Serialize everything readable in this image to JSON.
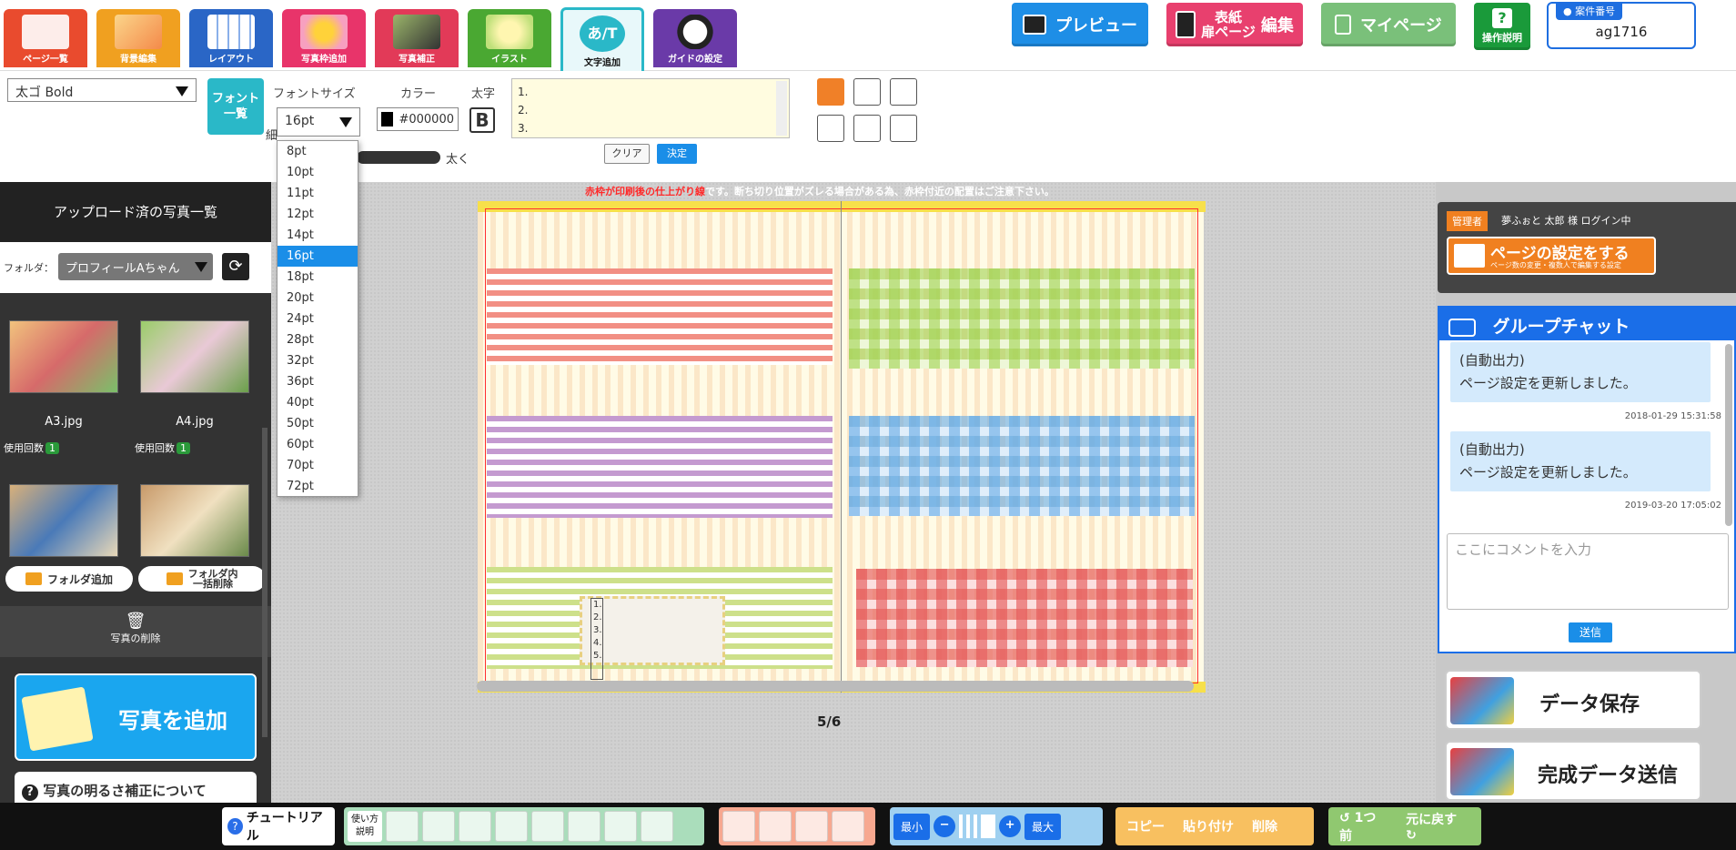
{
  "toolbar": {
    "tabs": [
      {
        "label": "ページ一覧",
        "color": "#e94b2e"
      },
      {
        "label": "背景編集",
        "color": "#f0a020"
      },
      {
        "label": "レイアウト",
        "color": "#2a66c6"
      },
      {
        "label": "写真枠追加",
        "color": "#e8346a"
      },
      {
        "label": "写真補正",
        "color": "#e23a58"
      },
      {
        "label": "イラスト",
        "color": "#4aa832"
      },
      {
        "label": "文字追加",
        "color": "#2ab8c8"
      },
      {
        "label": "ガイドの設定",
        "color": "#6a3aa8"
      }
    ],
    "preview_label": "プレビュー",
    "cover_line1": "表紙",
    "cover_line2": "扉ページ",
    "cover_edit": "編集",
    "mypage_label": "マイページ",
    "help_label": "操作説明",
    "case_number_label": "案件番号",
    "case_number_value": "ag1716"
  },
  "textpanel": {
    "font_name": "太ゴ Bold",
    "font_list_button": "フォント一覧",
    "font_size_label": "フォントサイズ",
    "font_size_value": "16pt",
    "color_label": "カラー",
    "color_value": "#000000",
    "bold_label": "太字",
    "bold_glyph": "B",
    "textarea_lines": [
      "1.",
      "2.",
      "3."
    ],
    "clear_button": "クリア",
    "confirm_button": "決定",
    "weight_thin": "細",
    "weight_thick": "太く",
    "font_sizes": [
      "8pt",
      "10pt",
      "11pt",
      "12pt",
      "14pt",
      "16pt",
      "18pt",
      "20pt",
      "24pt",
      "28pt",
      "32pt",
      "36pt",
      "40pt",
      "50pt",
      "60pt",
      "70pt",
      "72pt"
    ],
    "selected_size": "16pt"
  },
  "sidebar": {
    "title": "アップロード済の写真一覧",
    "folder_label": "フォルダ：",
    "folder_value": "プロフィールAちゃん",
    "photos": [
      {
        "name": "A3.jpg",
        "usage_label": "使用回数",
        "count": "1"
      },
      {
        "name": "A4.jpg",
        "usage_label": "使用回数",
        "count": "1"
      }
    ],
    "add_folder": "フォルダ追加",
    "folder_delete_line1": "フォルダ内",
    "folder_delete_line2": "一括削除",
    "delete_photos": "写真の削除",
    "add_photo": "写真を追加",
    "brightness_help": "写真の明るさ補正について"
  },
  "canvas": {
    "warning_red": "赤枠が印刷後の仕上がり線",
    "warning_white": "です。断ち切り位置がズレる場合がある為、赤枠付近の配置はご注意下さい。",
    "page_indicator": "5/6",
    "text_box_lines": [
      "1.",
      "2.",
      "3.",
      "4.",
      "5."
    ]
  },
  "rightpanel": {
    "admin_badge": "管理者",
    "login_text": "夢ふぉと 太郎 様 ログイン中",
    "page_settings_main": "ページの設定をする",
    "page_settings_sub": "ページ数の変更・複数人で編集する設定",
    "chat_title": "グループチャット",
    "messages": [
      {
        "line1": "(自動出力)",
        "line2": "ページ設定を更新しました。",
        "time": "2018-01-29 15:31:58"
      },
      {
        "line1": "(自動出力)",
        "line2": "ページ設定を更新しました。",
        "time": "2019-03-20 17:05:02"
      }
    ],
    "comment_placeholder": "ここにコメントを入力",
    "send_button": "送信",
    "save_data": "データ保存",
    "submit_data": "完成データ送信"
  },
  "bottombar": {
    "tutorial": "チュートリアル",
    "howto_line1": "使い方",
    "howto_line2": "説明",
    "zoom_min": "最小",
    "zoom_max": "最大",
    "copy": "コピー",
    "paste": "貼り付け",
    "delete": "削除",
    "undo": "1つ前",
    "redo": "元に戻す"
  },
  "colors": {
    "accent_blue": "#1a8ee8",
    "selected_size_bg": "#1a8ee8",
    "warning_red": "#ff2a2a"
  }
}
